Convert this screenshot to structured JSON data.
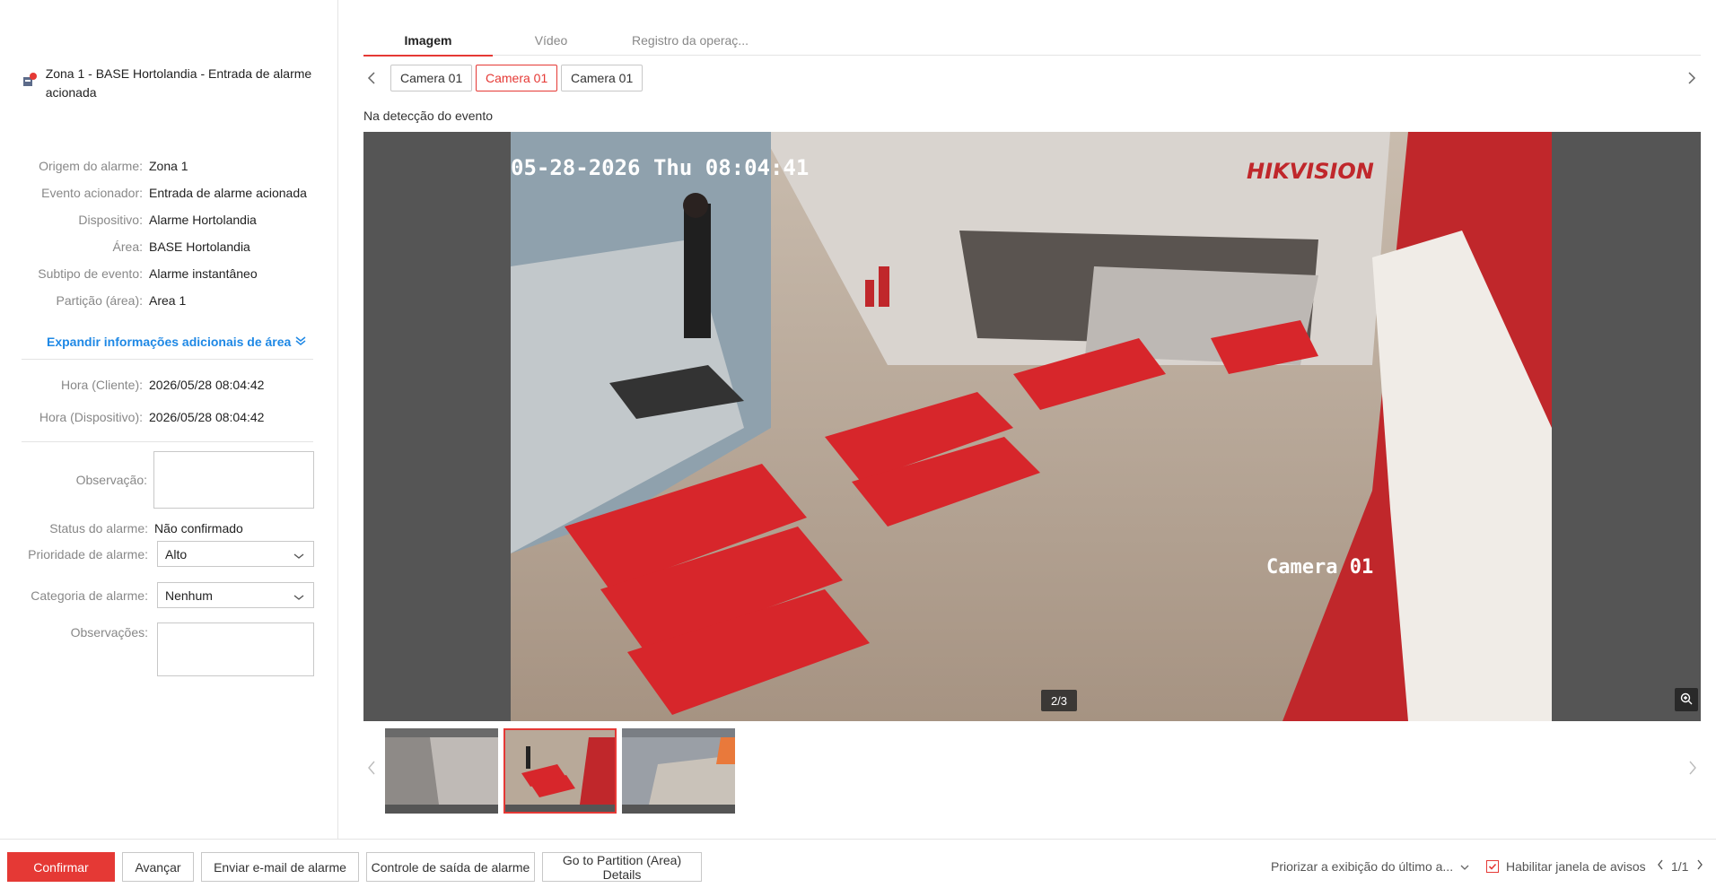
{
  "alarm": {
    "title": "Zona 1 - BASE Hortolandia - Entrada de alarme acionada",
    "details": [
      {
        "label": "Origem do alarme:",
        "value": "Zona 1"
      },
      {
        "label": "Evento acionador:",
        "value": "Entrada de alarme acionada"
      },
      {
        "label": "Dispositivo:",
        "value": "Alarme Hortolandia"
      },
      {
        "label": "Área:",
        "value": "BASE Hortolandia"
      },
      {
        "label": "Subtipo de evento:",
        "value": "Alarme instantâneo"
      },
      {
        "label": "Partição (área):",
        "value": "Area 1"
      }
    ],
    "expand_label": "Expandir informações adicionais de área",
    "times": [
      {
        "label": "Hora (Cliente):",
        "value": "2026/05/28 08:04:42"
      },
      {
        "label": "Hora (Dispositivo):",
        "value": "2026/05/28 08:04:42"
      }
    ],
    "observation_label": "Observação:",
    "status_label": "Status do alarme:",
    "status_value": "Não confirmado",
    "priority_label": "Prioridade de alarme:",
    "priority_value": "Alto",
    "category_label": "Categoria de alarme:",
    "category_value": "Nenhum",
    "remarks_label": "Observações:"
  },
  "tabs": [
    {
      "label": "Imagem",
      "active": true
    },
    {
      "label": "Vídeo",
      "active": false
    },
    {
      "label": "Registro da operaç...",
      "active": false
    }
  ],
  "cameras": [
    "Camera 01",
    "Camera 01",
    "Camera 01"
  ],
  "selected_camera": 1,
  "image": {
    "caption": "Na detecção do evento",
    "osd_timestamp": "05-28-2026 Thu 08:04:41",
    "osd_camera": "Camera 01",
    "brand": "HIKVISION",
    "counter": "2/3"
  },
  "thumbnails": {
    "count": 3,
    "selected": 1
  },
  "footer": {
    "confirm": "Confirmar",
    "advance": "Avançar",
    "send_email": "Enviar e-mail de alarme",
    "output_control": "Controle de saída de alarme",
    "partition_details": "Go to Partition (Area) Details",
    "prioritize": "Priorizar a exibição do último a...",
    "enable_popup": "Habilitar janela de avisos",
    "page": "1/1"
  },
  "colors": {
    "accent": "#e53935",
    "link": "#1e88e5"
  }
}
